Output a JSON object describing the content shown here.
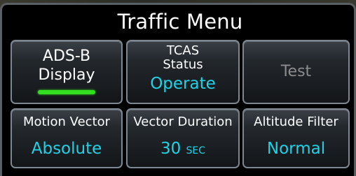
{
  "menu": {
    "title": "Traffic Menu"
  },
  "buttons": {
    "adsb": {
      "line1": "ADS-B",
      "line2": "Display",
      "annunciator_on": true
    },
    "tcas": {
      "line1": "TCAS",
      "line2": "Status",
      "value": "Operate"
    },
    "test": {
      "label": "Test"
    },
    "motion_vector": {
      "label": "Motion Vector",
      "value": "Absolute"
    },
    "vector_duration": {
      "label": "Vector Duration",
      "value": "30",
      "unit": "SEC"
    },
    "altitude_filter": {
      "label": "Altitude Filter",
      "value": "Normal"
    }
  },
  "colors": {
    "value_text": "#1fd3e6",
    "annunciator": "#33e01f",
    "disabled_text": "#8c8c8c"
  }
}
